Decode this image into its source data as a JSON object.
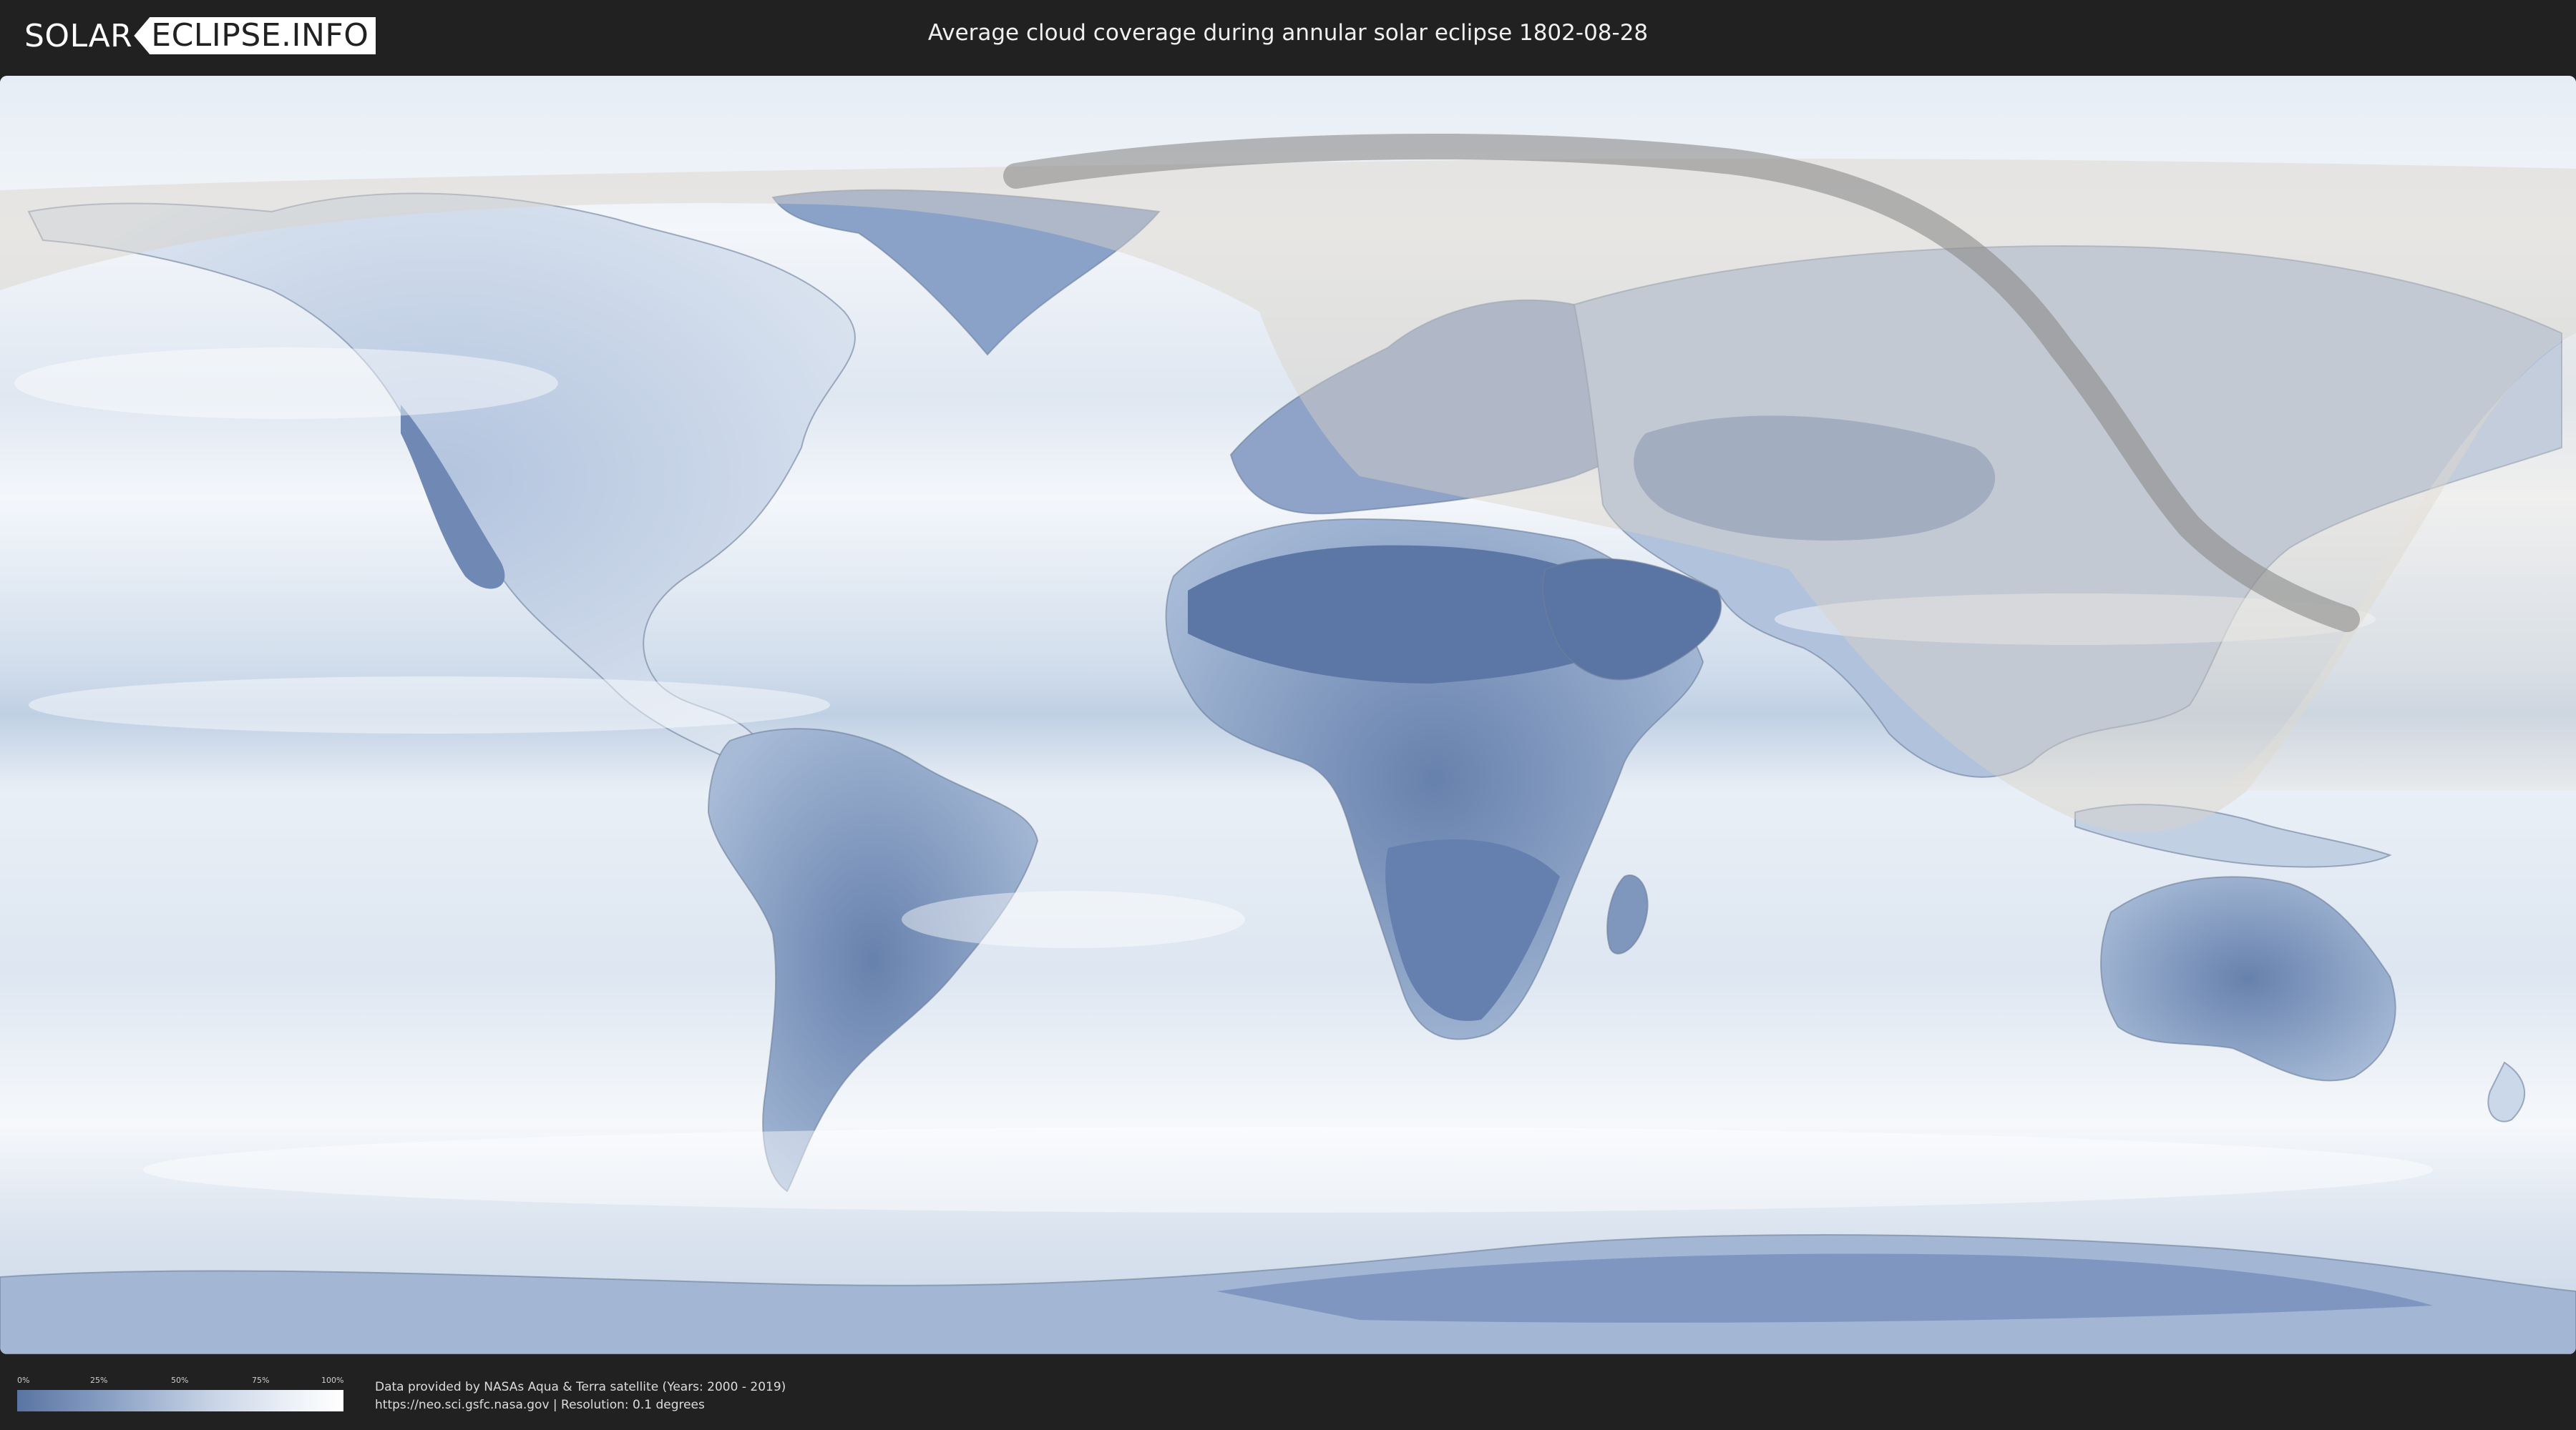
{
  "header": {
    "logo_left": "SOLAR",
    "logo_right": "ECLIPSE.INFO",
    "title": "Average cloud coverage during annular solar eclipse 1802-08-28"
  },
  "map": {
    "description_colors": {
      "ocean_clouds": "#f4f7fb",
      "clear_land": "#5f7aa8",
      "mid_cover": "#a9bcd8",
      "eclipse_path": "#8a8a8a",
      "visibility_overlay": "#d9d2c8"
    },
    "layers": [
      "cloud-coverage",
      "country-borders",
      "eclipse-visibility-zone",
      "annular-path"
    ]
  },
  "legend": {
    "ticks": [
      "0%",
      "25%",
      "50%",
      "75%",
      "100%"
    ],
    "gradient_start": "#5a74a3",
    "gradient_end": "#ffffff"
  },
  "credits": {
    "line1": "Data provided by NASAs Aqua & Terra satellite (Years: 2000 - 2019)",
    "line2": "https://neo.sci.gsfc.nasa.gov | Resolution: 0.1 degrees"
  }
}
